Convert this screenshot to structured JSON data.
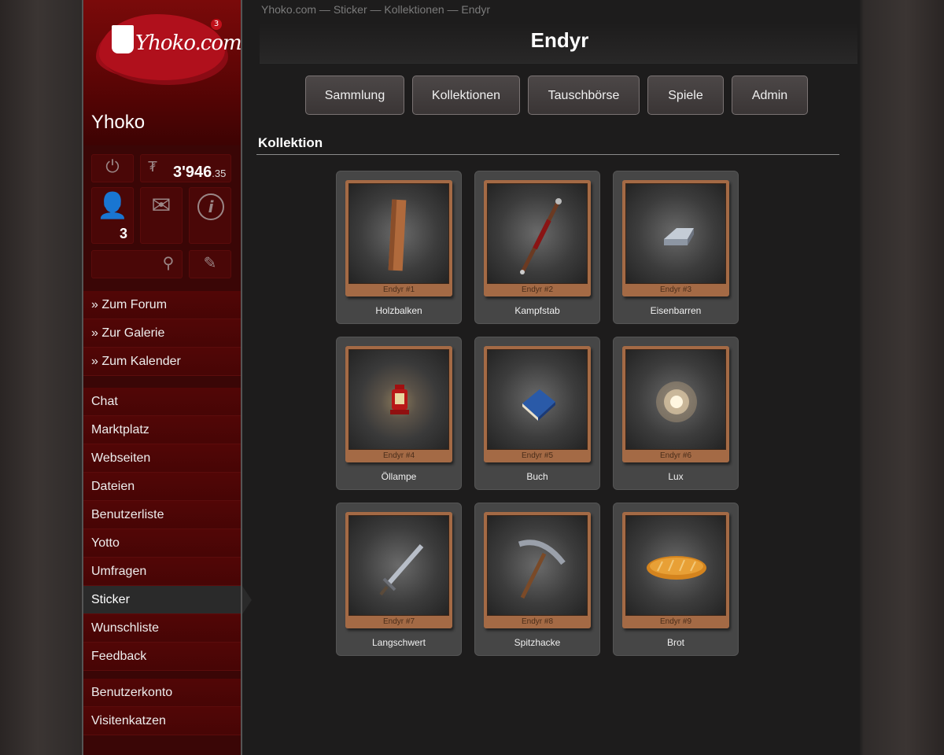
{
  "site": {
    "logo_text": "Yhoko.com",
    "notification_badge": "3",
    "username": "Yhoko"
  },
  "userbox": {
    "credits_main": "3'946",
    "credits_decimal": ".35",
    "friends_count": "3"
  },
  "quick_links": [
    {
      "label": "» Zum Forum"
    },
    {
      "label": "» Zur Galerie"
    },
    {
      "label": "» Zum Kalender"
    }
  ],
  "nav": [
    {
      "label": "Chat"
    },
    {
      "label": "Marktplatz"
    },
    {
      "label": "Webseiten"
    },
    {
      "label": "Dateien"
    },
    {
      "label": "Benutzerliste"
    },
    {
      "label": "Yotto"
    },
    {
      "label": "Umfragen"
    },
    {
      "label": "Sticker",
      "active": true
    },
    {
      "label": "Wunschliste"
    },
    {
      "label": "Feedback"
    }
  ],
  "account_nav": [
    {
      "label": "Benutzerkonto"
    },
    {
      "label": "Visitenkatzen"
    }
  ],
  "breadcrumb": "Yhoko.com — Sticker — Kollektionen — Endyr",
  "page_title": "Endyr",
  "tabs": [
    {
      "label": "Sammlung"
    },
    {
      "label": "Kollektionen"
    },
    {
      "label": "Tauschbörse"
    },
    {
      "label": "Spiele"
    },
    {
      "label": "Admin"
    }
  ],
  "section_heading": "Kollektion",
  "cards": [
    {
      "number": "Endyr #1",
      "name": "Holzbalken",
      "icon": "wooden-beam"
    },
    {
      "number": "Endyr #2",
      "name": "Kampfstab",
      "icon": "battle-staff"
    },
    {
      "number": "Endyr #3",
      "name": "Eisenbarren",
      "icon": "iron-bar"
    },
    {
      "number": "Endyr #4",
      "name": "Öllampe",
      "icon": "oil-lamp"
    },
    {
      "number": "Endyr #5",
      "name": "Buch",
      "icon": "book"
    },
    {
      "number": "Endyr #6",
      "name": "Lux",
      "icon": "light-spark"
    },
    {
      "number": "Endyr #7",
      "name": "Langschwert",
      "icon": "long-sword"
    },
    {
      "number": "Endyr #8",
      "name": "Spitzhacke",
      "icon": "pickaxe"
    },
    {
      "number": "Endyr #9",
      "name": "Brot",
      "icon": "bread"
    }
  ]
}
